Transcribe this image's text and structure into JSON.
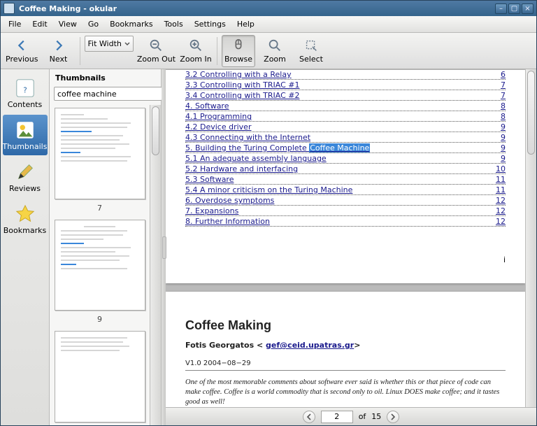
{
  "window": {
    "title": "Coffee Making - okular"
  },
  "menu": {
    "file": "File",
    "edit": "Edit",
    "view": "View",
    "go": "Go",
    "bookmarks": "Bookmarks",
    "tools": "Tools",
    "settings": "Settings",
    "help": "Help"
  },
  "toolbar": {
    "previous": "Previous",
    "next": "Next",
    "zoom_mode": "Fit Width",
    "zoom_out": "Zoom Out",
    "zoom_in": "Zoom In",
    "browse": "Browse",
    "zoom": "Zoom",
    "select": "Select"
  },
  "sidebar": {
    "contents": "Contents",
    "thumbnails": "Thumbnails",
    "reviews": "Reviews",
    "bookmarks": "Bookmarks",
    "panel_title": "Thumbnails",
    "search_value": "coffee machine",
    "thumb_a": "7",
    "thumb_b": "9"
  },
  "toc": {
    "r0": {
      "t": "3.2 Controlling with a Relay",
      "p": "6"
    },
    "r1": {
      "t": "3.3 Controlling with TRIAC #1",
      "p": "7"
    },
    "r2": {
      "t": "3.4 Controlling with TRIAC #2",
      "p": "7"
    },
    "r3": {
      "t": "4. Software",
      "p": "8"
    },
    "r4": {
      "t": "4.1 Programming",
      "p": "8"
    },
    "r5": {
      "t": "4.2 Device driver",
      "p": "9"
    },
    "r6": {
      "t": "4.3 Connecting with the Internet",
      "p": "9"
    },
    "r7_pre": "5. Building the Turing Complete ",
    "r7_hl": "Coffee Machine",
    "r7_p": "9",
    "r8": {
      "t": "5.1 An adequate assembly language",
      "p": "9"
    },
    "r9": {
      "t": "5.2 Hardware and interfacing",
      "p": "10"
    },
    "r10": {
      "t": "5.3 Software",
      "p": "11"
    },
    "r11": {
      "t": "5.4 A minor criticism on the Turing Machine",
      "p": "11"
    },
    "r12": {
      "t": "6. Overdose symptoms",
      "p": "12"
    },
    "r13": {
      "t": "7. Expansions",
      "p": "12"
    },
    "r14": {
      "t": "8. Further Information",
      "p": "12"
    },
    "page_num": "i"
  },
  "page2": {
    "title": "Coffee Making",
    "author_pre": "Fotis Georgatos < ",
    "author_email": "gef@ceid.upatras.gr",
    "author_post": ">",
    "version": "V1.0 2004−08−29",
    "intro": "One of the most memorable comments about software ever said is whether this or that piece of code can make coffee. Coffee is a world commodity that is second only to oil. Linux DOES make coffee; and it tastes good as well!"
  },
  "pager": {
    "current": "2",
    "of_label": "of",
    "total": "15"
  }
}
